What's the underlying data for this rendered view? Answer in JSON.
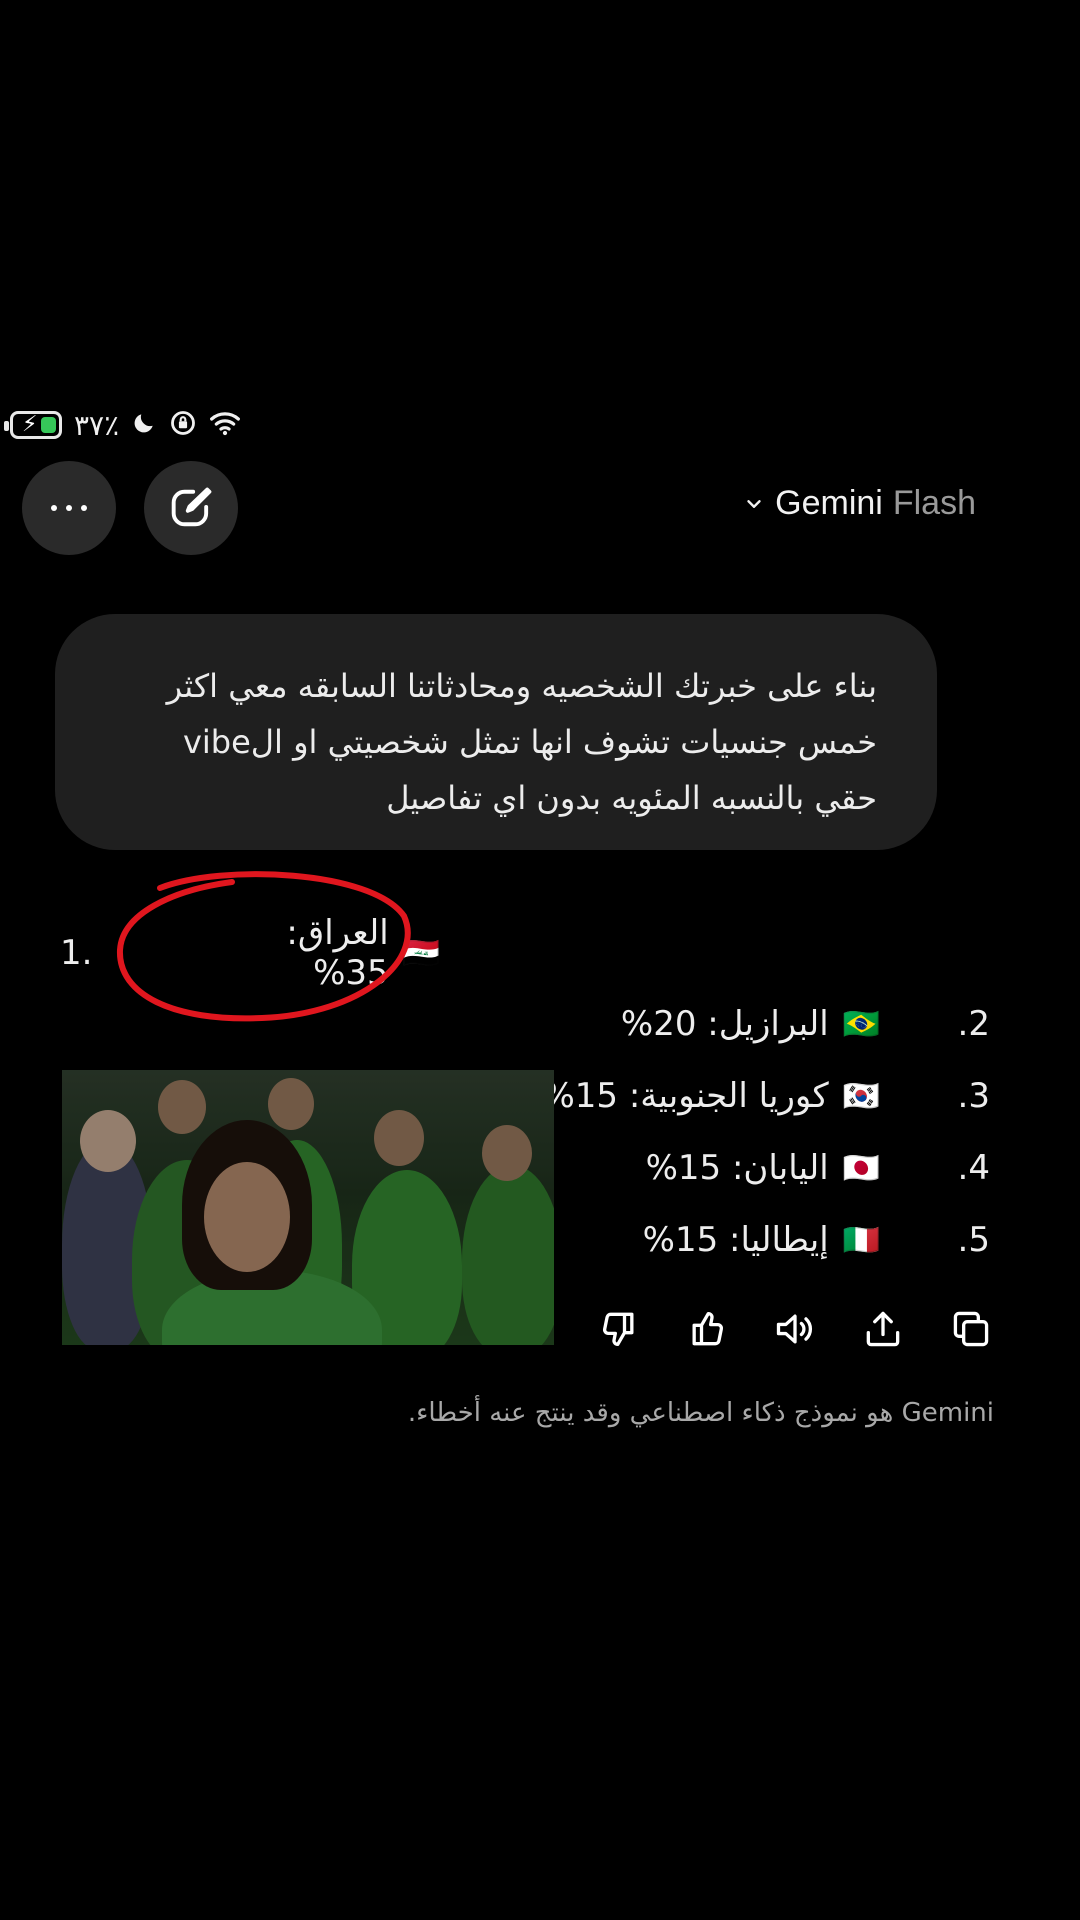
{
  "status_bar": {
    "battery_percent": "٣٧٪",
    "battery_level": 0.37,
    "accent_charging": "#36c759",
    "icons": [
      "battery-charging-icon",
      "moon-icon",
      "data-saver-icon",
      "wifi-icon"
    ]
  },
  "header": {
    "model_name": "Gemini",
    "model_variant": "Flash",
    "icons": [
      "more-icon",
      "new-chat-icon",
      "chevron-down-icon"
    ]
  },
  "prompt": {
    "lines": [
      "بناء على خبرتك الشخصيه ومحادثاتنا السابقه معي اكثر",
      "خمس جنسيات تشوف انها تمثل شخصيتي او الvibe",
      "حقي بالنسبه المئويه بدون اي تفاصيل"
    ]
  },
  "response": {
    "items": [
      {
        "number": "1.",
        "flag": "🇮🇶",
        "text": "العراق: 35%"
      },
      {
        "number": "2.",
        "flag": "🇧🇷",
        "text": "البرازيل: 20%"
      },
      {
        "number": "3.",
        "flag": "🇰🇷",
        "text": "كوريا الجنوبية: 15%"
      },
      {
        "number": "4.",
        "flag": "🇯🇵",
        "text": "اليابان: 15%"
      },
      {
        "number": "5.",
        "flag": "🇮🇹",
        "text": "إيطاليا: 15%"
      }
    ],
    "annotation_color": "#e0161e"
  },
  "actions": {
    "icons": [
      "copy-icon",
      "share-icon",
      "listen-icon",
      "thumbs-up-icon",
      "thumbs-down-icon"
    ]
  },
  "footer": {
    "disclaimer": "Gemini هو نموذج ذكاء اصطناعي وقد ينتج عنه أخطاء."
  }
}
